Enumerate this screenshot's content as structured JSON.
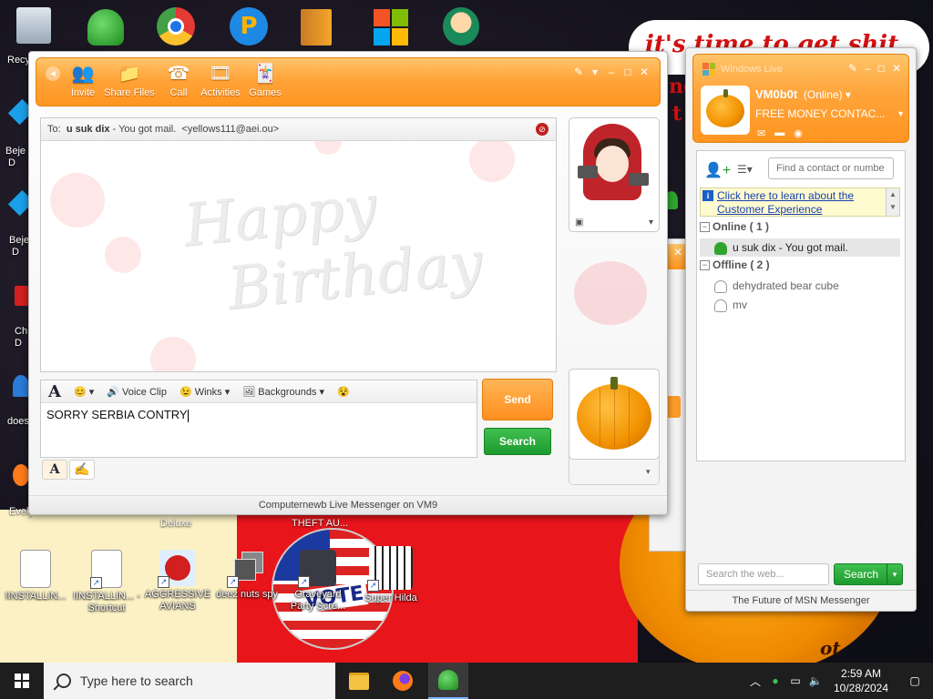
{
  "desktop": {
    "banner_text": "it's time to get shit",
    "banner_fragment_1": "nd",
    "banner_fragment_2": "t",
    "vote_text": "VOTE",
    "bottom_fragment": "ot",
    "left_partials": [
      "Recy",
      "Beje\nD",
      "Beje\nD",
      "Ch\nD",
      "does",
      "Evely"
    ],
    "icons": [
      {
        "label": "!INSTALLIN..."
      },
      {
        "label": "!INSTALLIN... - Shortcut"
      },
      {
        "label": "AGGRESSIVE AVIANS"
      },
      {
        "label": "deez nuts spy"
      },
      {
        "label": "Graveyard Party Scre..."
      },
      {
        "label": "Super Hilda"
      }
    ],
    "behind_labels": {
      "deluxe": "Deluxe",
      "theft": "THEFT AU..."
    }
  },
  "conversation": {
    "toolbar": {
      "invite": "Invite",
      "share_files": "Share Files",
      "call": "Call",
      "activities": "Activities",
      "games": "Games"
    },
    "to_label": "To:",
    "to_name": "u suk dix",
    "to_status": " - You got mail.",
    "to_email": "<yellows111@aei.ou>",
    "background_text": "Happy\nBirthday",
    "format_bar": {
      "voice_clip": "Voice Clip",
      "winks": "Winks",
      "backgrounds": "Backgrounds"
    },
    "compose_text": "SORRY SERBIA CONTRY",
    "send_label": "Send",
    "search_label": "Search",
    "status_bar": "Computernewb Live Messenger on VM9"
  },
  "contact_list": {
    "title": "Windows Live",
    "display_name": "VM0b0t",
    "presence": "(Online)",
    "personal_message": "FREE MONEY CONTAC...",
    "find_placeholder": "Find a contact or numbe",
    "promo_text": "Click here to learn about the Customer Experience",
    "online_group": "Online ( 1 )",
    "offline_group": "Offline ( 2 )",
    "online_contacts": [
      {
        "name": "u suk dix",
        "status": " - You got mail."
      }
    ],
    "offline_contacts": [
      {
        "name": "dehydrated bear cube"
      },
      {
        "name": "mv"
      }
    ],
    "search_placeholder": "Search the web...",
    "search_button": "Search",
    "footer": "The Future of MSN Messenger"
  },
  "taskbar": {
    "search_placeholder": "Type here to search",
    "time": "2:59 AM",
    "date": "10/28/2024"
  },
  "colors": {
    "accent_orange": "#ff9a2a",
    "accent_green": "#22a032",
    "taskbar": "#1e1e1e"
  }
}
